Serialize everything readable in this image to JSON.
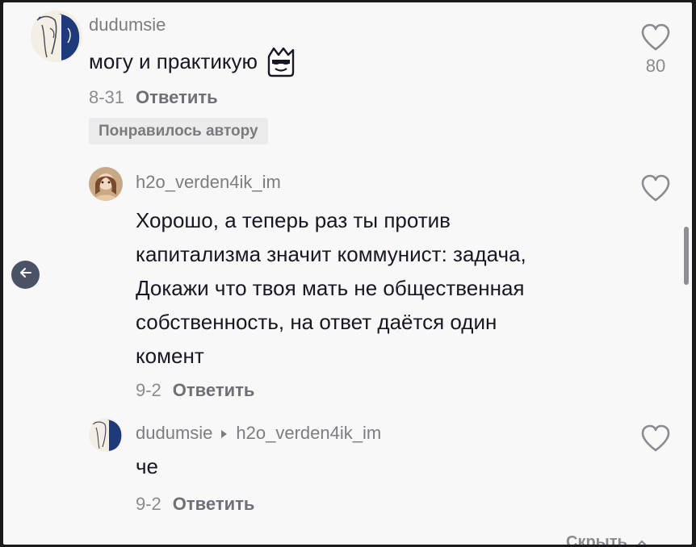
{
  "comments": [
    {
      "username": "dudumsie",
      "text": "могу и практикую",
      "emoji": "sunglasses-smile-emoji",
      "date": "8-31",
      "reply_label": "Ответить",
      "likes": "80",
      "badge": "Понравилось автору"
    },
    {
      "username": "h2o_verden4ik_im",
      "text_lines": [
        "Хорошо, а теперь раз ты против",
        "капитализма значит коммунист: задача,",
        "Докажи что твоя мать не общественная",
        "собственность, на ответ даётся один",
        "комент"
      ],
      "date": "9-2",
      "reply_label": "Ответить"
    },
    {
      "username": "dudumsie",
      "reply_to": "h2o_verden4ik_im",
      "text": "че",
      "date": "9-2",
      "reply_label": "Ответить"
    }
  ],
  "footer": {
    "hide_label": "Скрыть"
  },
  "colors": {
    "background": "#f8f8f9",
    "text": "#161823",
    "muted": "#8a8b91"
  }
}
